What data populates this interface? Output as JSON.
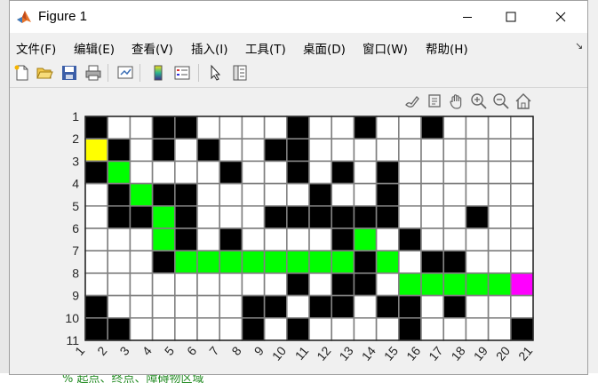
{
  "window": {
    "title": "Figure 1",
    "controls": [
      "minimize",
      "maximize",
      "close"
    ]
  },
  "menubar": {
    "items": [
      "文件(F)",
      "编辑(E)",
      "查看(V)",
      "插入(I)",
      "工具(T)",
      "桌面(D)",
      "窗口(W)",
      "帮助(H)"
    ]
  },
  "toolbar": {
    "buttons": [
      "new-figure",
      "open-file",
      "save",
      "print",
      "link-plot",
      "insert-colorbar",
      "insert-legend",
      "edit-plot",
      "property-inspector"
    ]
  },
  "axes_toolbar": {
    "buttons": [
      "brush",
      "data-tips",
      "pan",
      "zoom-in",
      "zoom-out",
      "restore-view"
    ]
  },
  "background_text": "% 起点、终点、障碍物区域",
  "chart_data": {
    "type": "heatmap",
    "title": "",
    "x_ticks": [
      "1",
      "2",
      "3",
      "4",
      "5",
      "6",
      "7",
      "8",
      "9",
      "10",
      "11",
      "12",
      "13",
      "14",
      "15",
      "16",
      "17",
      "18",
      "19",
      "20",
      "21"
    ],
    "y_ticks": [
      "1",
      "2",
      "3",
      "4",
      "5",
      "6",
      "7",
      "8",
      "9",
      "10",
      "11"
    ],
    "legend_colors": {
      "W": "#ffffff",
      "B": "#000000",
      "G": "#00ff00",
      "Y": "#ffff00",
      "M": "#ff00ff"
    },
    "grid_color": "#808080",
    "rows": [
      "BWWBBWWWWBWWBWWBWWWW",
      "YBWBWBWWBBWWWWWWWWWW",
      "BGWWWWBWWBWBWBWWWWWW",
      "WBGBBWWWWWBWWBWWWWWW",
      "WBBGBWWWBBBBBBWWWBWW",
      "WWWGBWBWWWWBGWBWWWWW",
      "WWWBGGGGGGGGBGWBBWWW",
      "WWWWWWWWWBWBBWGGGGGM",
      "BWWWWWWBBWBBWBBWBWWW",
      "BBWWWWWBWBWWWWBWWWWB"
    ]
  }
}
